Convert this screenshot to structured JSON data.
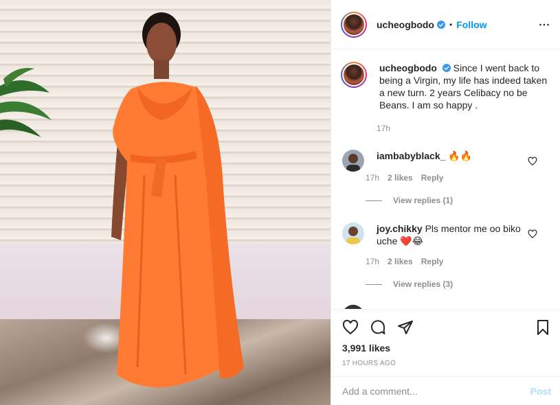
{
  "post": {
    "username": "ucheogbodo",
    "verified": true,
    "separator": "•",
    "follow_label": "Follow",
    "photo_desc": "photo"
  },
  "caption": {
    "username": "ucheogbodo",
    "text": "Since I went back to being a Virgin, my life has indeed taken a new turn. 2 years Celibacy no be Beans. I am so happy .",
    "time": "17h"
  },
  "comments": [
    {
      "username": "iambabyblack_",
      "text": "🔥🔥",
      "time": "17h",
      "likes": "2 likes",
      "reply_label": "Reply",
      "view_replies": "View replies (1)"
    },
    {
      "username": "joy.chikky",
      "text": "Pls mentor me oo biko uche ❤️😂",
      "time": "17h",
      "likes": "2 likes",
      "reply_label": "Reply",
      "view_replies": "View replies (3)"
    }
  ],
  "actions": {
    "likes": "3,991 likes",
    "time_ago": "17 HOURS AGO"
  },
  "add_comment": {
    "placeholder": "Add a comment...",
    "post_label": "Post"
  },
  "icons": [
    "more-icon",
    "verified-icon",
    "heart-icon",
    "comment-icon",
    "share-icon",
    "bookmark-icon"
  ],
  "colors": {
    "link_blue": "#0095f6",
    "post_disabled": "#b2dffc",
    "muted": "#8e8e8e",
    "dress_orange": "#ff7a33"
  }
}
